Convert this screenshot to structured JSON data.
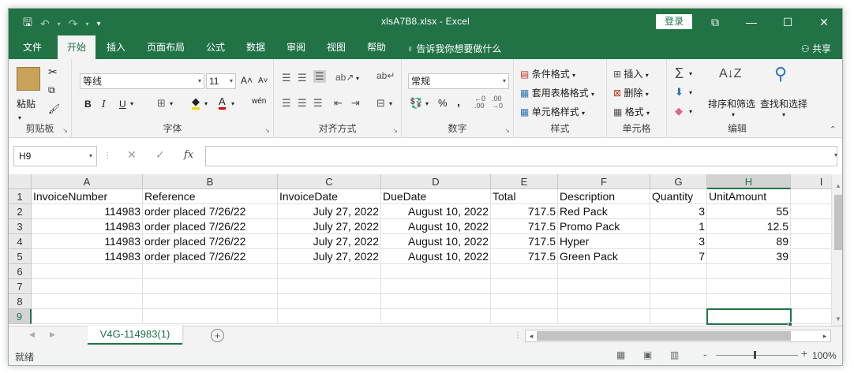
{
  "titlebar": {
    "title": "xlsA7B8.xlsx  -  Excel",
    "login_label": "登录",
    "qat_save": "🖫",
    "qat_undo": "↶",
    "qat_redo": "↷",
    "qat_more": "▾",
    "ribbon_display": "⧉",
    "minimize": "—",
    "maximize": "☐",
    "close": "✕"
  },
  "tabs": [
    {
      "label": "文件"
    },
    {
      "label": "开始",
      "active": true
    },
    {
      "label": "插入"
    },
    {
      "label": "页面布局"
    },
    {
      "label": "公式"
    },
    {
      "label": "数据"
    },
    {
      "label": "审阅"
    },
    {
      "label": "视图"
    },
    {
      "label": "帮助"
    }
  ],
  "tellme": "告诉我你想要做什么",
  "share": "共享",
  "ribbon": {
    "clipboard": {
      "label": "剪贴板",
      "paste": "粘贴"
    },
    "font": {
      "label": "字体",
      "name": "等线",
      "size": "11",
      "bold": "B",
      "italic": "I",
      "underline": "U",
      "grow": "A˄",
      "shrink": "A˅"
    },
    "alignment": {
      "label": "对齐方式"
    },
    "number": {
      "label": "数字",
      "format": "常规",
      "percent": "%",
      "comma": ","
    },
    "styles": {
      "label": "样式",
      "conditional": "条件格式",
      "table": "套用表格格式",
      "cell": "单元格样式"
    },
    "cells": {
      "label": "单元格",
      "insert": "插入",
      "delete": "删除",
      "format": "格式"
    },
    "editing": {
      "label": "编辑",
      "sort": "排序和筛选",
      "find": "查找和选择"
    }
  },
  "formula_bar": {
    "name_box": "H9",
    "cancel": "✕",
    "enter": "✓",
    "fx": "fx",
    "formula": ""
  },
  "grid": {
    "columns": [
      "A",
      "B",
      "C",
      "D",
      "E",
      "F",
      "G",
      "H",
      "I"
    ],
    "rows": [
      "1",
      "2",
      "3",
      "4",
      "5",
      "6",
      "7",
      "8",
      "9"
    ],
    "selected_cell": "H9",
    "headers": [
      "InvoiceNumber",
      "Reference",
      "InvoiceDate",
      "DueDate",
      "Total",
      "Description",
      "Quantity",
      "UnitAmount"
    ],
    "data": [
      [
        "114983",
        "order placed 7/26/22",
        "July 27, 2022",
        "August 10, 2022",
        "717.5",
        "Red Pack",
        "3",
        "55"
      ],
      [
        "114983",
        "order placed 7/26/22",
        "July 27, 2022",
        "August 10, 2022",
        "717.5",
        "Promo Pack",
        "1",
        "12.5"
      ],
      [
        "114983",
        "order placed 7/26/22",
        "July 27, 2022",
        "August 10, 2022",
        "717.5",
        "Hyper",
        "3",
        "89"
      ],
      [
        "114983",
        "order placed 7/26/22",
        "July 27, 2022",
        "August 10, 2022",
        "717.5",
        "Green Pack",
        "7",
        "39"
      ]
    ]
  },
  "sheets": [
    {
      "label": "V4G-114983(1)",
      "active": true
    }
  ],
  "status": {
    "ready": "就绪",
    "zoom_minus": "-",
    "zoom_plus": "+",
    "zoom": "100%"
  },
  "colors": {
    "accent": "#217346"
  }
}
